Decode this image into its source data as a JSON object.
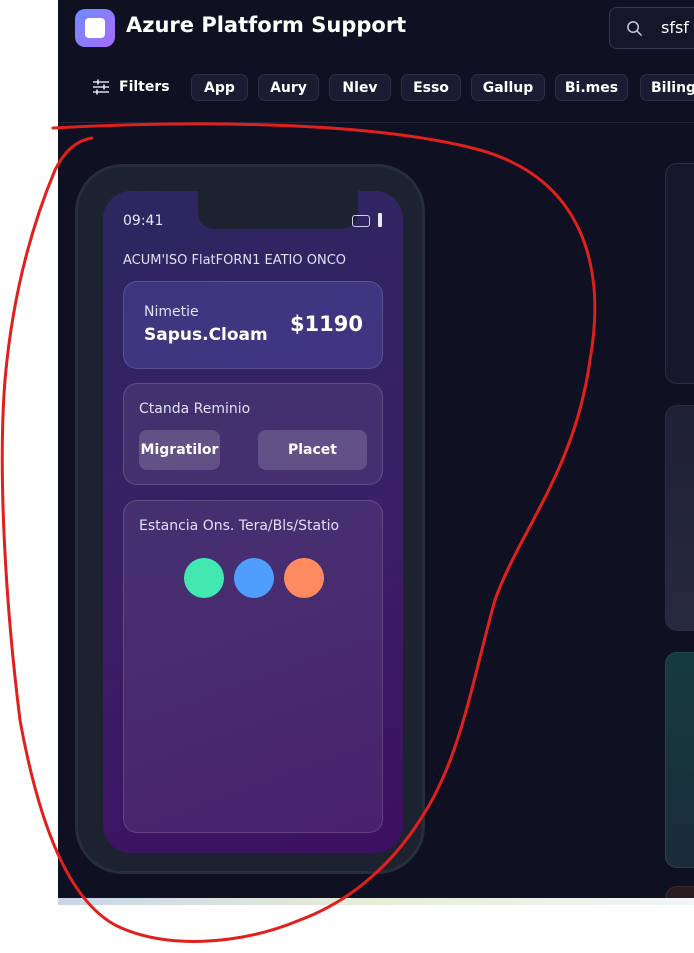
{
  "header": {
    "title": "Azure Platform Support",
    "search": {
      "value": "sfsf",
      "icon": "search-icon"
    }
  },
  "filter_bar": {
    "filters_label": "Filters",
    "chips": [
      "App",
      "Aury",
      "Nlev",
      "Esso",
      "Gallup",
      "Bi.mes",
      "Biling"
    ]
  },
  "phone": {
    "status_time": "09:41",
    "app_heading": "ACUM'ISO FlatFORN1 EATIO ONCO",
    "summary_card": {
      "label": "Nimetie",
      "name": "Sapus.Cloam",
      "amount": "$1190"
    },
    "reminder_card": {
      "title": "Ctanda Reminio",
      "buttons": [
        "Migratilor",
        "Placet"
      ]
    },
    "status_card": {
      "title": "Estancia Ons. Tera/Bls/Statio",
      "dots": [
        "#43e8b0",
        "#4f9dff",
        "#ff8a60"
      ]
    }
  },
  "colors": {
    "background": "#0f1122",
    "accent_gradient": [
      "#6d8cff",
      "#a76bff"
    ],
    "annotation": "#e0201c"
  }
}
